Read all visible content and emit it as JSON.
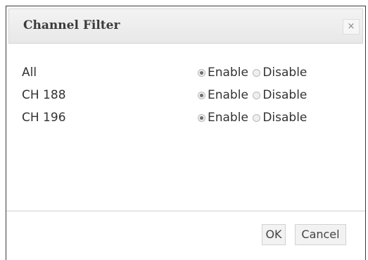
{
  "dialog": {
    "title": "Channel Filter",
    "close_glyph": "×",
    "rows": [
      {
        "label": "All",
        "enable_label": "Enable",
        "disable_label": "Disable",
        "selected": "Enable"
      },
      {
        "label": "CH 188",
        "enable_label": "Enable",
        "disable_label": "Disable",
        "selected": "Enable"
      },
      {
        "label": "CH 196",
        "enable_label": "Enable",
        "disable_label": "Disable",
        "selected": "Enable"
      }
    ],
    "ok_label": "OK",
    "cancel_label": "Cancel"
  }
}
